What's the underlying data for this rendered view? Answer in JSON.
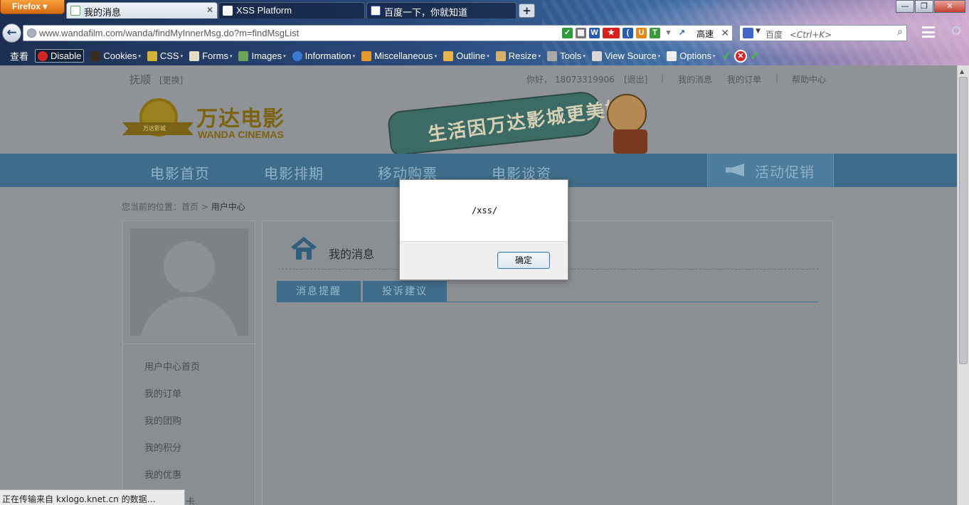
{
  "browser": {
    "app_button": "Firefox",
    "tabs": [
      {
        "title": "我的消息",
        "active": true
      },
      {
        "title": "XSS Platform",
        "active": false
      },
      {
        "title": "百度一下，你就知道",
        "active": false
      }
    ],
    "new_tab": "+",
    "window_buttons": [
      "—",
      "❐",
      "✕"
    ],
    "url": "www.wandafilm.com/wanda/findMyInnerMsg.do?m=findMsgList",
    "speed_label": "高速",
    "search": {
      "engine": "百度",
      "placeholder": "<Ctrl+K>"
    }
  },
  "devtoolbar": {
    "first": "查看",
    "disable": "Disable",
    "items": [
      "Cookies",
      "CSS",
      "Forms",
      "Images",
      "Information",
      "Miscellaneous",
      "Outline",
      "Resize",
      "Tools",
      "View Source",
      "Options"
    ]
  },
  "site": {
    "city": "抚顺",
    "change": "[更换]",
    "greeting": "你好， 18073319906",
    "logout": "[退出]",
    "my_messages": "我的消息",
    "my_orders": "我的订单",
    "help": "帮助中心",
    "logo_cn": "万达电影",
    "logo_en": "WANDA CINEMAS",
    "logo_ribbon": "万达影城",
    "banner_text": "生活因万达影城更美好",
    "nav": [
      "电影首页",
      "电影排期",
      "移动购票",
      "电影谈资"
    ],
    "promo": "活动促销",
    "breadcrumb_prefix": "您当前的位置：首页 > ",
    "breadcrumb_current": "用户中心",
    "sidebar": [
      "用户中心首页",
      "我的订单",
      "我的团购",
      "我的积分",
      "我的优惠",
      "卡"
    ],
    "content_title": "我的消息",
    "content_tabs": [
      "消息提醒",
      "投诉建议"
    ]
  },
  "dialog": {
    "message": "/xss/",
    "ok": "确定"
  },
  "status": "正在传输来自 kxlogo.knet.cn 的数据…"
}
